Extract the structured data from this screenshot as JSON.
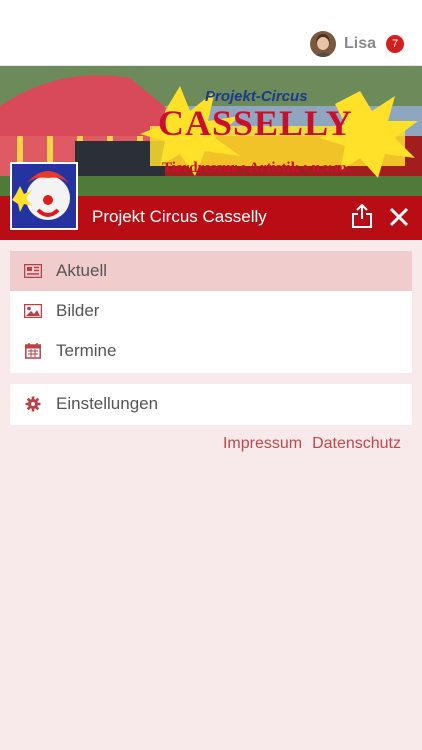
{
  "header": {
    "username": "Lisa",
    "notification_count": "7"
  },
  "banner": {
    "logo_title": "Projekt-Circus",
    "logo_main": "CASSELLY",
    "logo_sub": "Tierdressur • Artistik • u.v.m."
  },
  "titlebar": {
    "site_title": "Projekt Circus Casselly"
  },
  "menu": {
    "items": [
      {
        "label": "Aktuell",
        "icon": "newspaper-icon",
        "active": true
      },
      {
        "label": "Bilder",
        "icon": "image-icon",
        "active": false
      },
      {
        "label": "Termine",
        "icon": "calendar-icon",
        "active": false
      }
    ],
    "settings": {
      "label": "Einstellungen",
      "icon": "gear-icon"
    }
  },
  "footer_links": {
    "impressum": "Impressum",
    "datenschutz": "Datenschutz"
  },
  "colors": {
    "accent": "#b90d16",
    "active_bg": "#f0cccc",
    "page_bg": "#f8eaea",
    "link": "#c0474c",
    "badge": "#d41f1f"
  }
}
